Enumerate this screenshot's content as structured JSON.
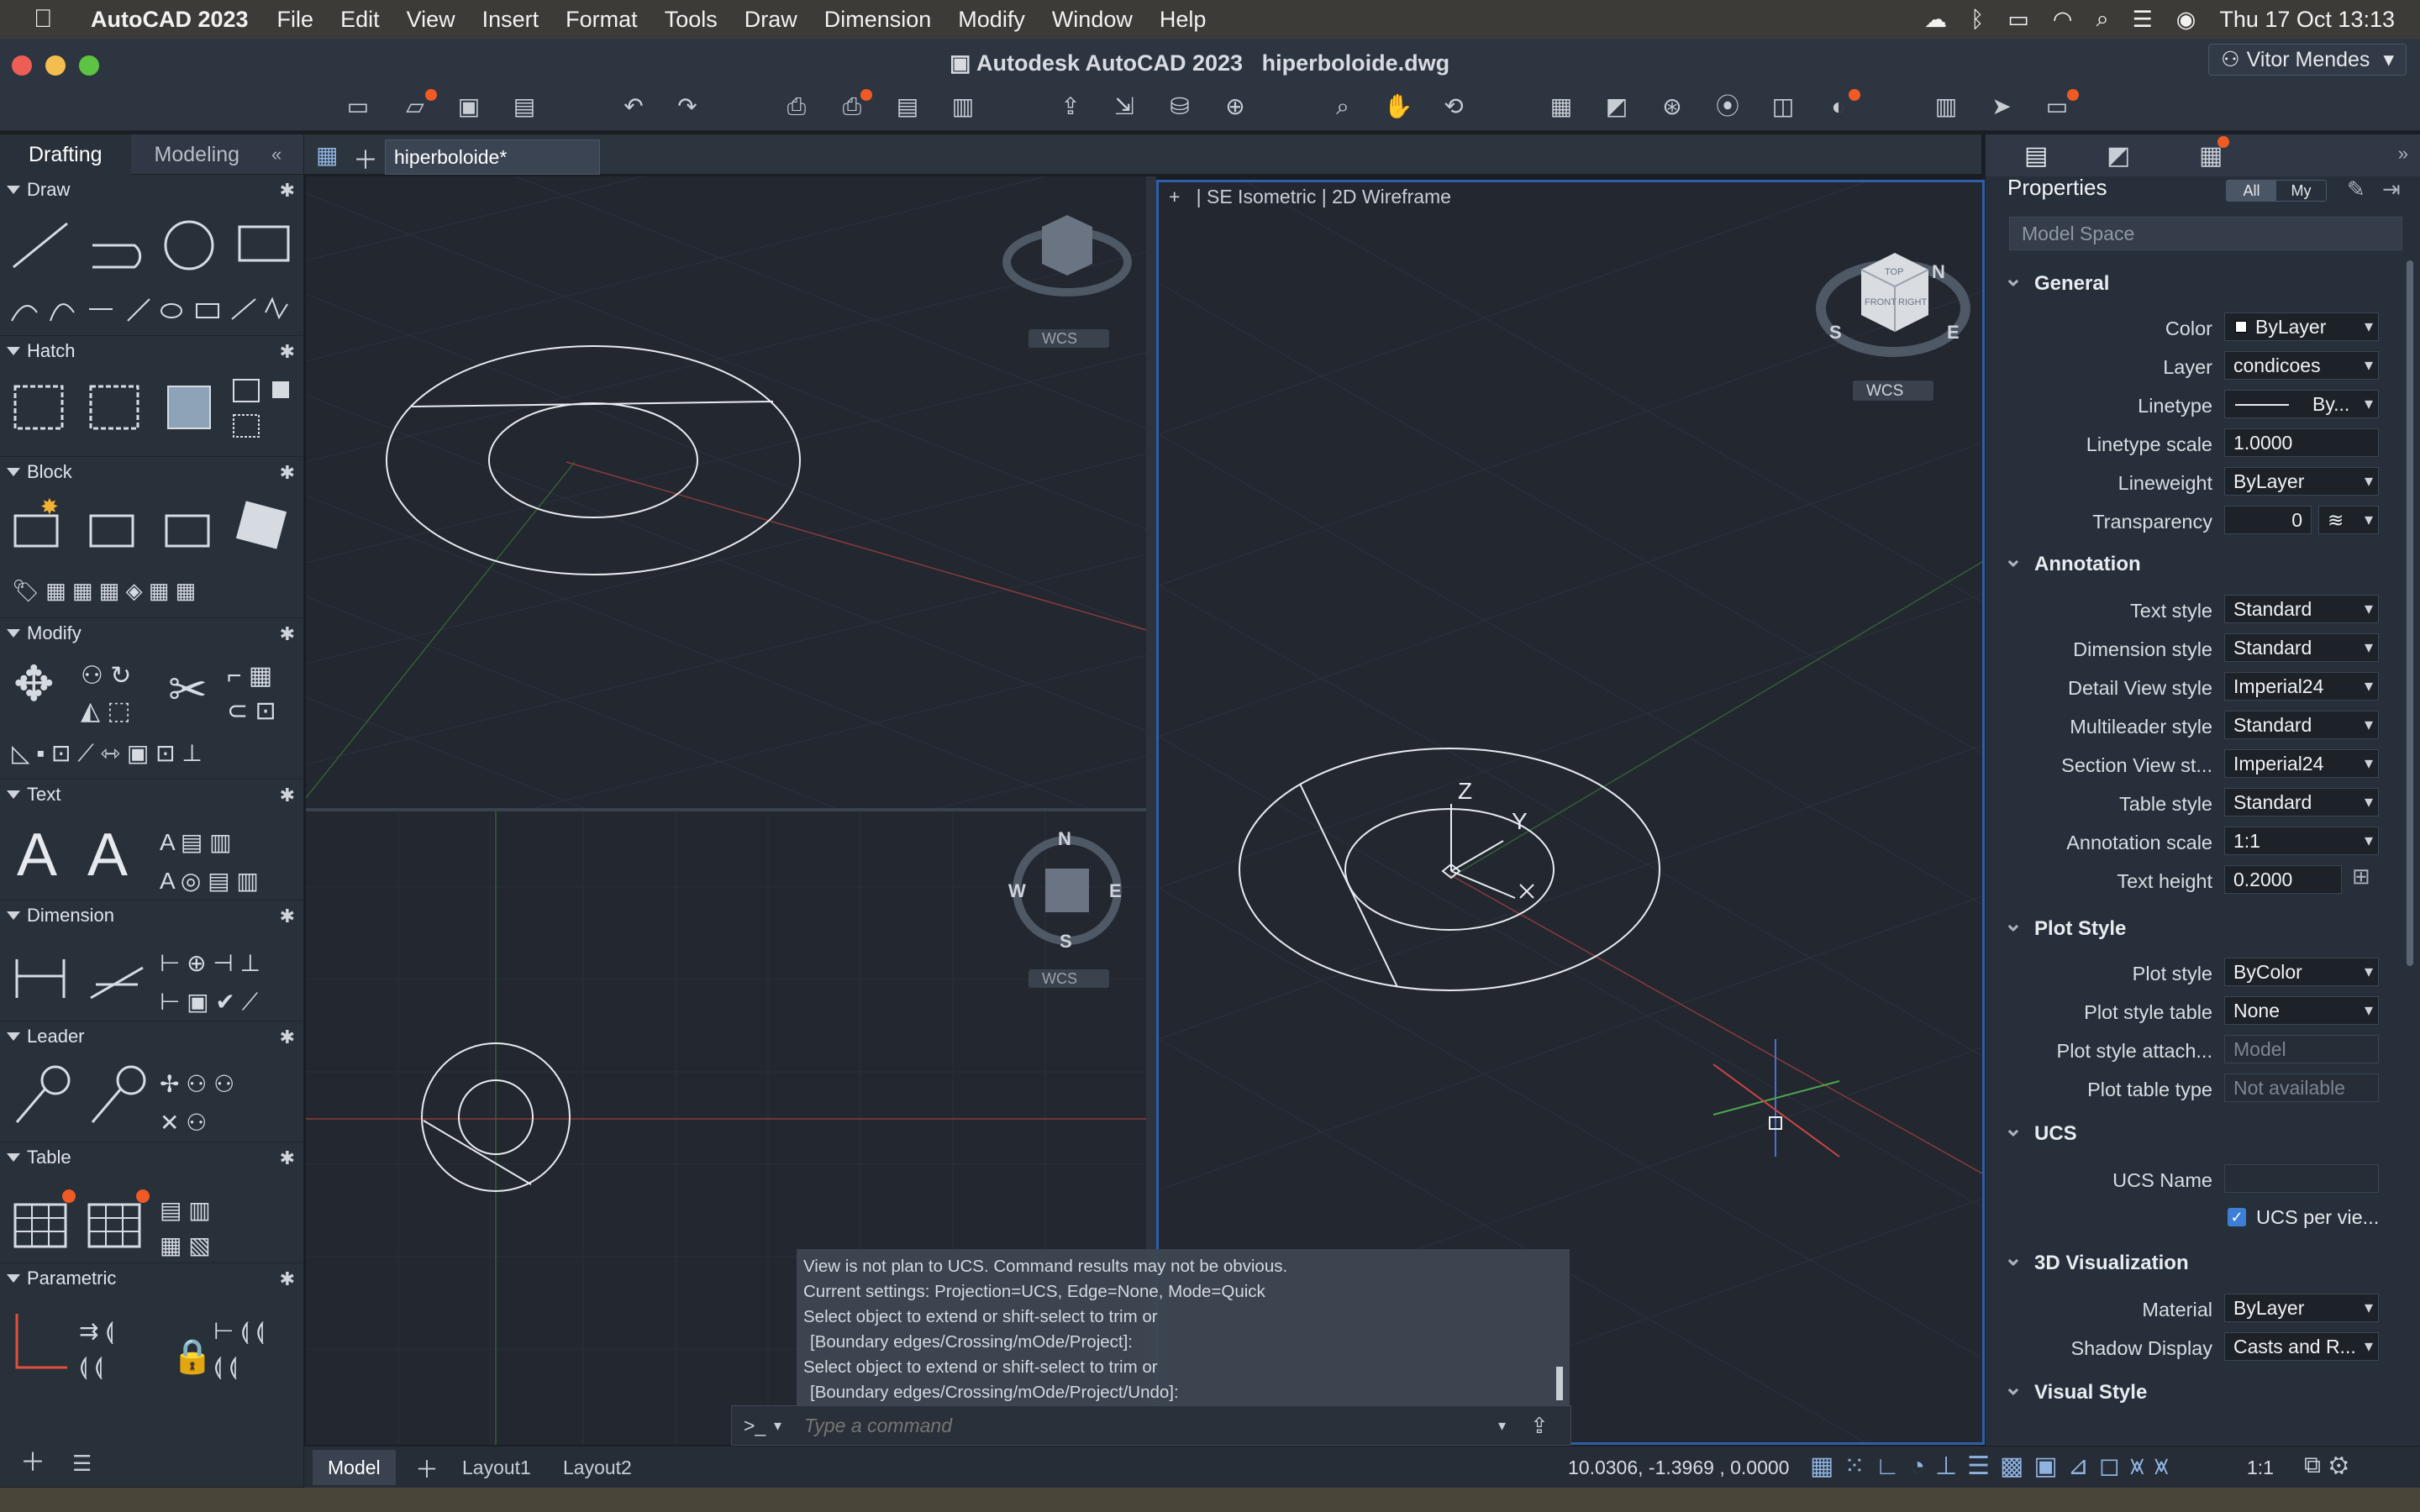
{
  "menubar": {
    "app": "AutoCAD 2023",
    "items": [
      "File",
      "Edit",
      "View",
      "Insert",
      "Format",
      "Tools",
      "Draw",
      "Dimension",
      "Modify",
      "Window",
      "Help"
    ],
    "clock": "Thu 17 Oct  13:13"
  },
  "window": {
    "title": "Autodesk AutoCAD 2023",
    "file": "hiperboloide.dwg",
    "user": "Vitor Mendes"
  },
  "left_panel": {
    "tabs": [
      "Drafting",
      "Modeling"
    ],
    "sections": [
      "Draw",
      "Hatch",
      "Block",
      "Modify",
      "Text",
      "Dimension",
      "Leader",
      "Table",
      "Parametric"
    ]
  },
  "doc": {
    "tab": "hiperboloide*"
  },
  "viewport": {
    "header_plus": "+",
    "view": "SE Isometric",
    "style": "2D Wireframe",
    "wcs": "WCS",
    "n": "N",
    "s": "S",
    "e": "E",
    "w": "W",
    "top": "TOP",
    "front": "FRONT",
    "right": "RIGHT",
    "z": "Z",
    "y": "Y"
  },
  "properties": {
    "title": "Properties",
    "toggle_all": "All",
    "toggle_my": "My",
    "space": "Model Space",
    "general": "General",
    "annotation": "Annotation",
    "plot_style": "Plot Style",
    "ucs": "UCS",
    "viz3d": "3D Visualization",
    "visual_style": "Visual Style",
    "color_label": "Color",
    "color": "ByLayer",
    "layer_label": "Layer",
    "layer": "condicoes",
    "linetype_label": "Linetype",
    "linetype": "By...",
    "lts_label": "Linetype scale",
    "lts": "1.0000",
    "lw_label": "Lineweight",
    "lw": "ByLayer",
    "tr_label": "Transparency",
    "tr": "0",
    "ts_label": "Text style",
    "ts": "Standard",
    "ds_label": "Dimension style",
    "ds": "Standard",
    "dv_label": "Detail View style",
    "dv": "Imperial24",
    "ml_label": "Multileader style",
    "ml": "Standard",
    "sv_label": "Section View st...",
    "sv": "Imperial24",
    "tbs_label": "Table style",
    "tbs": "Standard",
    "as_label": "Annotation scale",
    "as": "1:1",
    "th_label": "Text height",
    "th": "0.2000",
    "ps_label": "Plot style",
    "ps": "ByColor",
    "pst_label": "Plot style table",
    "pst": "None",
    "psa_label": "Plot style attach...",
    "psa": "Model",
    "ptt_label": "Plot table type",
    "ptt": "Not available",
    "ucsn_label": "UCS Name",
    "ucsn": "",
    "ucspv": "UCS per vie...",
    "mat_label": "Material",
    "mat": "ByLayer",
    "sd_label": "Shadow Display",
    "sd": "Casts and R..."
  },
  "command": {
    "history": [
      "View is not plan to UCS. Command results may not be obvious.",
      "Current settings: Projection=UCS, Edge=None, Mode=Quick",
      "Select object to extend or shift-select to trim or",
      "[Boundary edges/Crossing/mOde/Project]:",
      "Select object to extend or shift-select to trim or",
      "[Boundary edges/Crossing/mOde/Project/Undo]:"
    ],
    "prompt": ">_",
    "placeholder": "Type a command"
  },
  "status": {
    "tabs": [
      "Model",
      "Layout1",
      "Layout2"
    ],
    "coords": "10.0306,  -1.3969 , 0.0000",
    "scale": "1:1"
  }
}
